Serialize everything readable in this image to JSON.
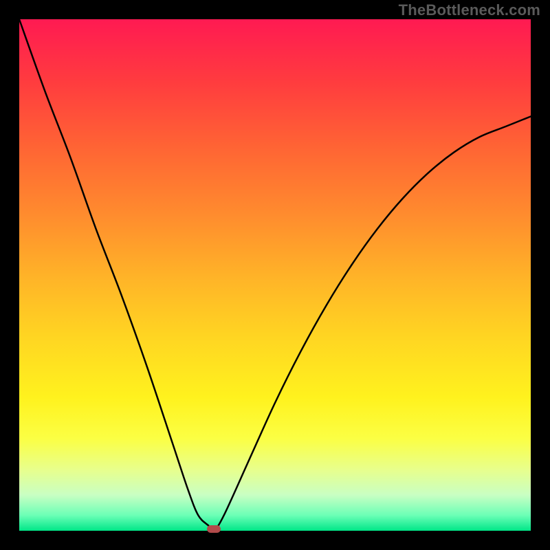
{
  "watermark": "TheBottleneck.com",
  "colors": {
    "background": "#000000",
    "curve": "#000000",
    "marker": "#b14a4a",
    "gradient_top": "#ff1a52",
    "gradient_bottom": "#00e688"
  },
  "chart_data": {
    "type": "line",
    "title": "",
    "xlabel": "",
    "ylabel": "",
    "xlim": [
      0,
      100
    ],
    "ylim": [
      0,
      100
    ],
    "curve": {
      "x": [
        0,
        5,
        10,
        15,
        20,
        25,
        30,
        33,
        35,
        37,
        38,
        40,
        45,
        50,
        55,
        60,
        65,
        70,
        75,
        80,
        85,
        90,
        95,
        100
      ],
      "y": [
        100,
        86,
        73,
        59,
        46,
        32,
        17,
        8,
        3,
        1,
        0,
        3,
        14,
        25,
        35,
        44,
        52,
        59,
        65,
        70,
        74,
        77,
        79,
        81
      ]
    },
    "minimum_point": {
      "x": 38,
      "y": 0
    },
    "marker": {
      "x": 38,
      "y": 0
    }
  }
}
